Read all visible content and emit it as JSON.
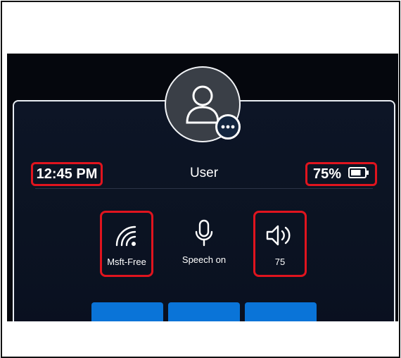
{
  "status": {
    "time": "12:45 PM",
    "user": "User",
    "battery_text": "75%",
    "battery_level": 0.75
  },
  "quick_settings": [
    {
      "icon": "wifi-icon",
      "label": "Msft-Free"
    },
    {
      "icon": "microphone-icon",
      "label": "Speech on"
    },
    {
      "icon": "speaker-icon",
      "label": "75"
    }
  ],
  "colors": {
    "highlight": "#e0141e",
    "button": "#0a74d8",
    "panel": "#0d1526"
  }
}
